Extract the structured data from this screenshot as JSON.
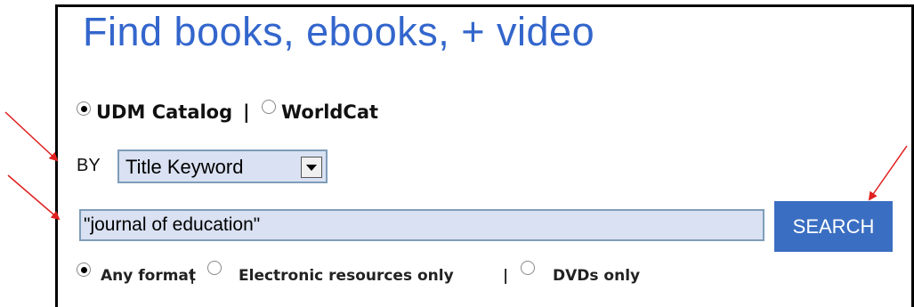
{
  "search_box": {
    "title": "Find books, ebooks, + video",
    "catalog_options": [
      {
        "label": "UDM Catalog",
        "checked": true
      },
      {
        "label": "WorldCat",
        "checked": false
      }
    ],
    "separator": "|",
    "by_label": "BY",
    "search_type_selected": "Title Keyword",
    "query_value": "\"journal of education\"",
    "search_button_label": "SEARCH",
    "format_options": [
      {
        "label": "Any format",
        "checked": true
      },
      {
        "label": "Electronic resources only",
        "checked": false
      },
      {
        "label": "DVDs only",
        "checked": false
      }
    ]
  },
  "colors": {
    "title": "#3366cc",
    "search_button": "#3a6ec2",
    "field_background": "#d9e1f2",
    "annotation_arrow": "#e02020"
  },
  "annotations": {
    "arrow_count": 3,
    "arrow_targets": [
      "search-type-select",
      "search-input",
      "search-button"
    ]
  }
}
